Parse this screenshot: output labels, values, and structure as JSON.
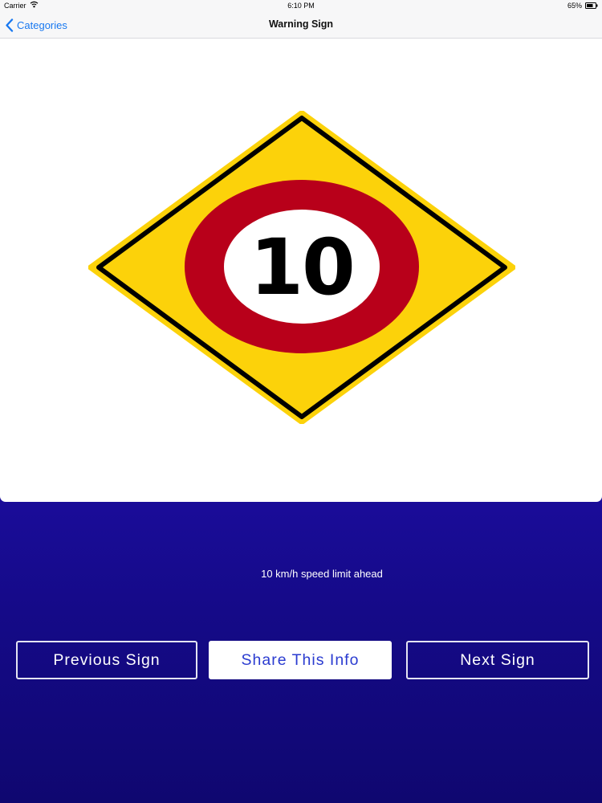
{
  "status_bar": {
    "carrier": "Carrier",
    "time": "6:10 PM",
    "battery": "65%"
  },
  "nav": {
    "back_label": "Categories",
    "title": "Warning Sign"
  },
  "sign": {
    "speed_value": "10",
    "colors": {
      "diamond_fill": "#fcd20a",
      "border": "#000000",
      "ring": "#b8001a",
      "center": "#ffffff"
    }
  },
  "description": "10 km/h speed limit ahead",
  "buttons": {
    "previous": "Previous Sign",
    "share": "Share This Info",
    "next": "Next Sign"
  },
  "theme": {
    "accent": "#1878f0",
    "background": "#150a88"
  }
}
